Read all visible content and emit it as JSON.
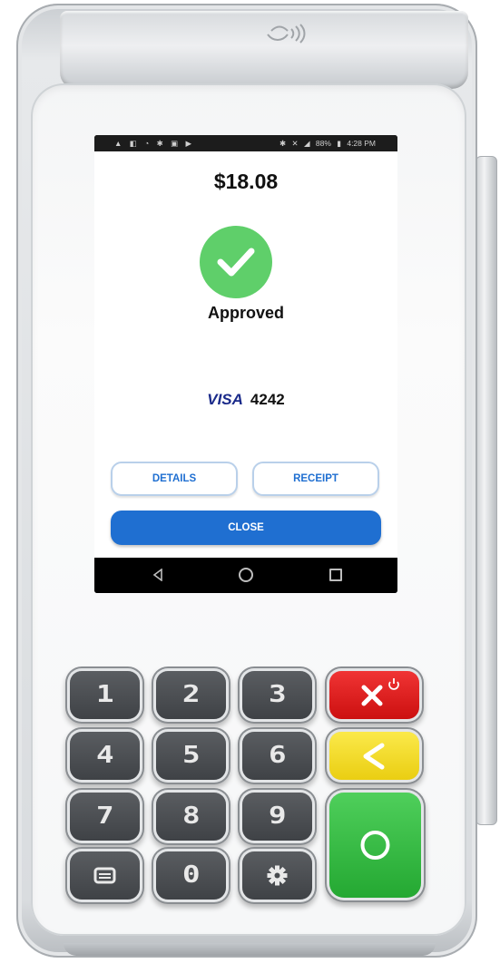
{
  "screen": {
    "status_bar": {
      "left_icons": "▲ ◧ ◔ ✱ ▣ ▶",
      "bluetooth": "✱",
      "mute": "✕",
      "battery": "88%",
      "time": "4:28 PM"
    },
    "transaction": {
      "amount": "$18.08",
      "status": "Approved",
      "status_color": "#5fcf6a",
      "card_brand": "VISA",
      "card_last4": "4242"
    },
    "buttons": {
      "details": "DETAILS",
      "receipt": "RECEIPT",
      "close": "CLOSE"
    },
    "accent_color": "#1f6fd1"
  },
  "keypad": {
    "digits": [
      "1",
      "2",
      "3",
      "4",
      "5",
      "6",
      "7",
      "8",
      "9",
      "0"
    ],
    "function_keys": {
      "menu": "menu-icon",
      "settings": "gear-icon",
      "cancel": "x-power-icon",
      "clear": "back-arrow-icon",
      "enter": "circle-icon"
    },
    "colors": {
      "cancel": "#e52222",
      "clear": "#f5dd2b",
      "enter": "#3cbf48"
    }
  }
}
